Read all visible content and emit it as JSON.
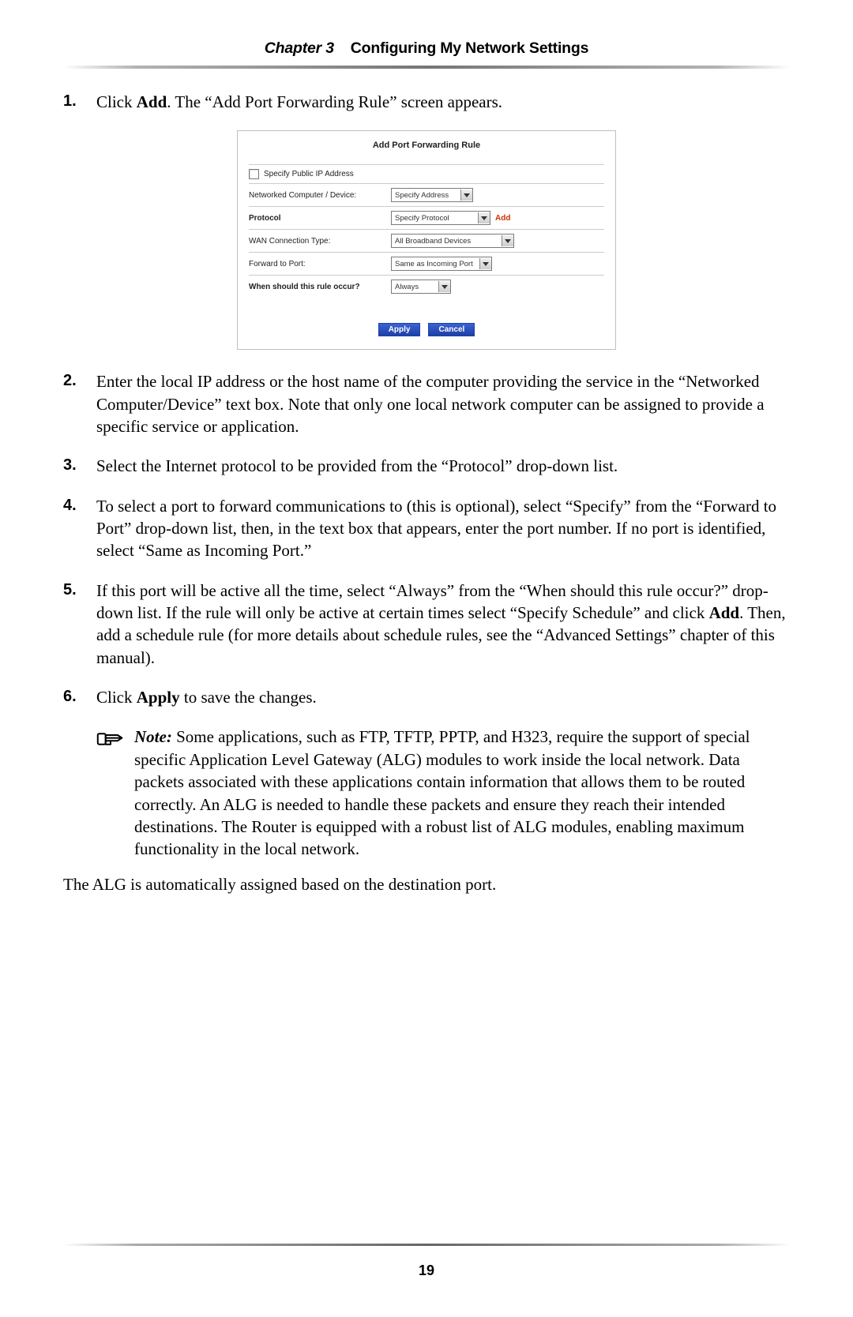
{
  "header": {
    "chapterLabel": "Chapter 3",
    "title": "Configuring My Network Settings"
  },
  "steps": {
    "s1": {
      "num": "1.",
      "pre": "Click ",
      "bold": "Add",
      "post": ". The “Add Port Forwarding Rule” screen appears."
    },
    "s2": {
      "num": "2.",
      "text": "Enter the local IP address or the host name of the computer providing the service in the “Networked Computer/Device” text box. Note that only one local network computer can be assigned to provide a specific service or application."
    },
    "s3": {
      "num": "3.",
      "text": "Select the Internet protocol to be provided from the “Protocol” drop-down list."
    },
    "s4": {
      "num": "4.",
      "text": "To select a port to forward communications to (this is optional), select “Specify” from the “Forward to Port” drop-down list, then, in the text box that appears, enter the port number. If no port is identified, select “Same as Incoming Port.”"
    },
    "s5": {
      "num": "5.",
      "pre": "If this port will be active all the time, select “Always” from the “When should this rule occur?” drop-down list. If the rule will only be active at certain times select “Specify Schedule” and click ",
      "bold": "Add",
      "post": ". Then, add a schedule rule (for more details about schedule rules, see the “Advanced Settings” chapter of this manual)."
    },
    "s6": {
      "num": "6.",
      "pre": "Click ",
      "bold": "Apply",
      "post": " to save the changes."
    }
  },
  "dialog": {
    "title": "Add Port Forwarding Rule",
    "specifyPubIp": "Specify Public IP Address",
    "rows": {
      "ncd": {
        "label": "Networked Computer / Device:",
        "select": "Specify Address"
      },
      "protocol": {
        "label": "Protocol",
        "select": "Specify Protocol",
        "addLink": "Add"
      },
      "wan": {
        "label": "WAN Connection Type:",
        "select": "All Broadband Devices"
      },
      "fwd": {
        "label": "Forward to Port:",
        "select": "Same as Incoming Port"
      },
      "when": {
        "label": "When should this rule occur?",
        "select": "Always"
      }
    },
    "buttons": {
      "apply": "Apply",
      "cancel": "Cancel"
    }
  },
  "note": {
    "label": "Note:",
    "text": " Some applications, such as FTP, TFTP, PPTP, and H323, require the support of special specific Application Level Gateway (ALG) modules to work inside the local network. Data packets associated with these applications contain information that allows them to be routed correctly. An ALG is needed to handle these packets and ensure they reach their intended destinations. The Router is equipped with a robust list of ALG modules, enabling maximum functionality in the local network."
  },
  "afterNote": "The ALG is automatically assigned based on the destination port.",
  "pageNumber": "19"
}
